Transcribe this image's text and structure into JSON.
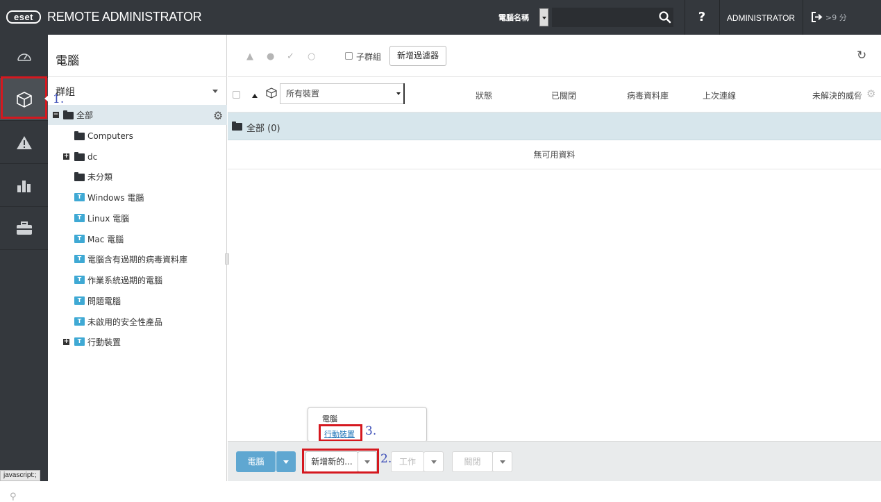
{
  "header": {
    "logo_text": "eset",
    "app_title": "REMOTE ADMINISTRATOR",
    "search_label": "電腦名稱",
    "search_value": "",
    "help_label": "?",
    "user_label": "ADMINISTRATOR",
    "logout_time": ">9 分"
  },
  "rail": {
    "items": [
      {
        "icon": "dashboard-icon"
      },
      {
        "icon": "computers-icon",
        "active": true
      },
      {
        "icon": "threats-icon"
      },
      {
        "icon": "reports-icon"
      },
      {
        "icon": "admin-icon"
      }
    ],
    "status_text": "javascript:;"
  },
  "tree": {
    "title": "電腦",
    "groups_label": "群組",
    "rows": [
      {
        "label": "全部",
        "type": "folder",
        "expander": "minus"
      },
      {
        "label": "Computers",
        "type": "folder"
      },
      {
        "label": "dc",
        "type": "folder",
        "expander": "plus"
      },
      {
        "label": "未分類",
        "type": "folder"
      },
      {
        "label": "Windows 電腦",
        "type": "filter"
      },
      {
        "label": "Linux 電腦",
        "type": "filter"
      },
      {
        "label": "Mac 電腦",
        "type": "filter"
      },
      {
        "label": "電腦含有過期的病毒資料庫",
        "type": "filter"
      },
      {
        "label": "作業系統過期的電腦",
        "type": "filter"
      },
      {
        "label": "問題電腦",
        "type": "filter"
      },
      {
        "label": "未啟用的安全性產品",
        "type": "filter"
      },
      {
        "label": "行動裝置",
        "type": "filter",
        "expander": "plus"
      }
    ]
  },
  "toolbar": {
    "subgroup_label": "子群組",
    "add_filter_label": "新增過濾器"
  },
  "table": {
    "device_select": "所有裝置",
    "columns": [
      "狀態",
      "已關閉",
      "病毒資料庫",
      "上次連線",
      "未解決的威脅"
    ],
    "group_row_label": "全部 (0)",
    "empty_text": "無可用資料"
  },
  "bottom": {
    "computers_btn": "電腦",
    "add_new_btn": "新增新的...",
    "tasks_btn": "工作",
    "close_btn": "關閉"
  },
  "popup": {
    "item1": "電腦",
    "item2": "行動裝置"
  },
  "annotations": {
    "step1": "1.",
    "step2": "2.",
    "step3": "3."
  },
  "colors": {
    "dark_chrome": "#34383d",
    "accent_blue": "#5fa7d1",
    "highlight_red": "#d5181f",
    "selected_row": "#dfe9ee",
    "annotation": "#3d4fb8"
  }
}
